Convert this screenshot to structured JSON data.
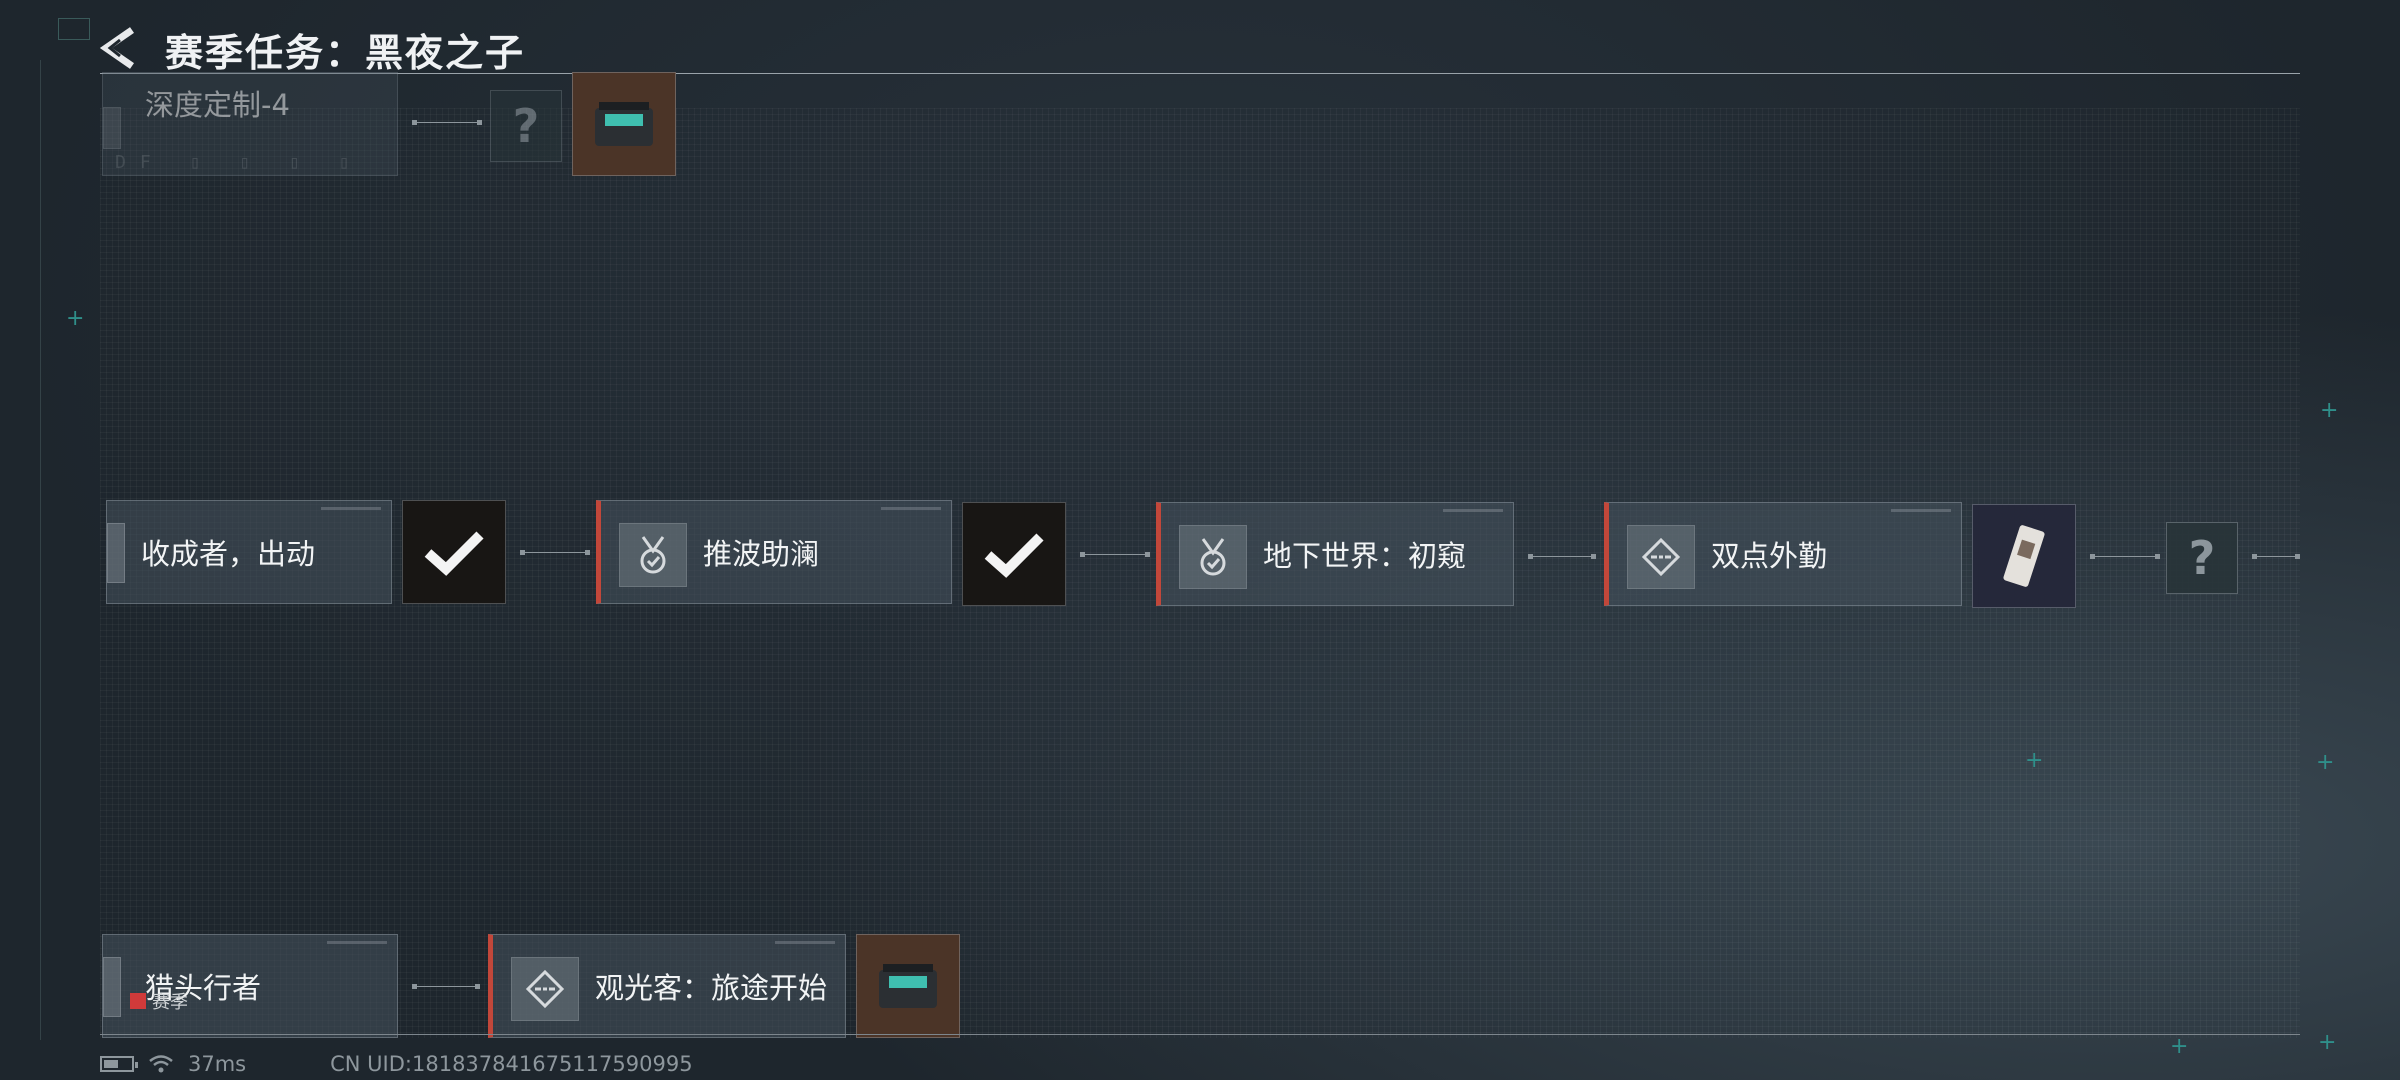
{
  "header": {
    "title": "赛季任务：黑夜之子"
  },
  "tasks_top": [
    {
      "label": "深度定制-4",
      "faint_sub": "DF ▯ ▯ ▯ ▯"
    }
  ],
  "tasks_mid": [
    {
      "label": "收成者，出动"
    },
    {
      "label": "推波助澜"
    },
    {
      "label": "地下世界：初窥"
    },
    {
      "label": "双点外勤"
    }
  ],
  "tasks_bottom": [
    {
      "label": "猎头行者",
      "badge": "赛季"
    },
    {
      "label": "观光客：旅途开始"
    }
  ],
  "unknown_glyph": "?",
  "status": {
    "ping": "37ms",
    "uid": "CN UID:181837841675117590995"
  },
  "colors": {
    "accent_red": "#c2473a",
    "teal": "#2f8f8a"
  }
}
